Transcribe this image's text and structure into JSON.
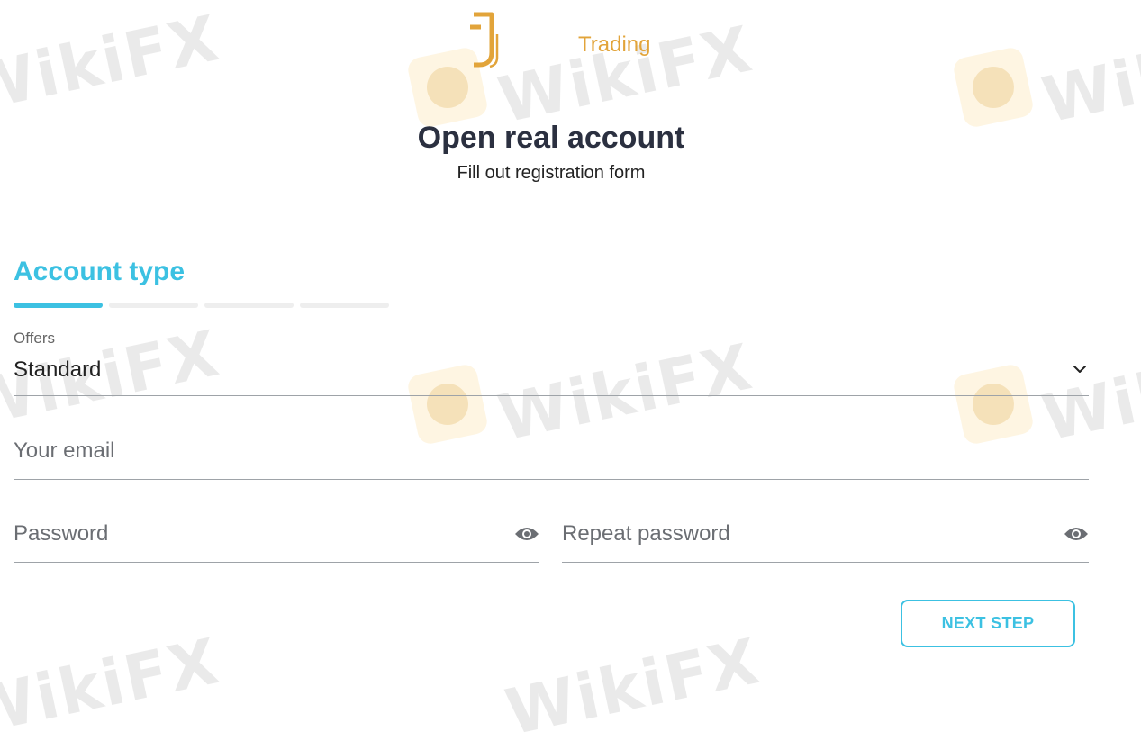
{
  "brand": {
    "name": "Trading",
    "logo_glyph": "J-logo-icon",
    "accent_color": "#e2a43a"
  },
  "header": {
    "title": "Open real account",
    "subtitle": "Fill out registration form"
  },
  "wizard": {
    "section_title": "Account type",
    "total_steps": 4,
    "current_step": 1,
    "active_color": "#3cc1e2"
  },
  "form": {
    "offers": {
      "label": "Offers",
      "value": "Standard"
    },
    "email": {
      "placeholder": "Your email"
    },
    "password": {
      "placeholder": "Password"
    },
    "repeat_password": {
      "placeholder": "Repeat password"
    },
    "next_label": "NEXT STEP"
  },
  "watermark": {
    "text": "WikiFX"
  }
}
